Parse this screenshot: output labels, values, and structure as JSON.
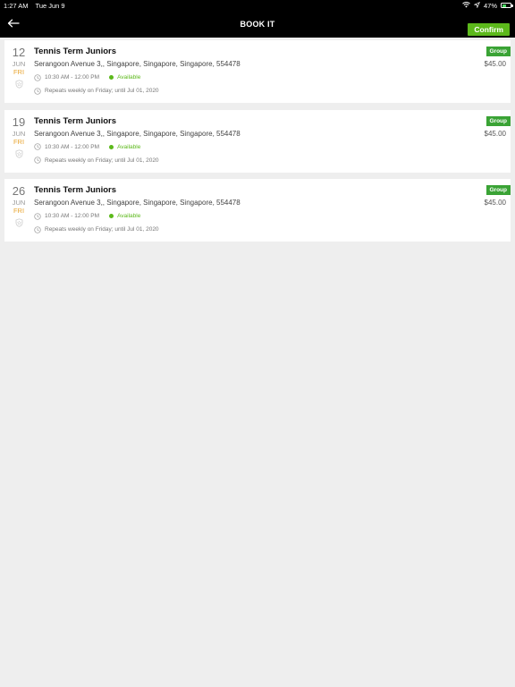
{
  "status_bar": {
    "time": "1:27 AM",
    "date": "Tue Jun 9",
    "battery_percent": "47%",
    "battery_level": 0.47
  },
  "nav": {
    "title": "BOOK IT",
    "back_icon": "arrow-left-icon",
    "confirm_label": "Confirm"
  },
  "colors": {
    "accent_green": "#5cb91b",
    "tag_green": "#3aa335",
    "weekday_orange": "#e8a531",
    "nav_bg": "#000000",
    "page_bg": "#eeeeee"
  },
  "sessions": [
    {
      "day": "12",
      "month": "JUN",
      "weekday": "FRI",
      "title": "Tennis Term Juniors",
      "address": "Serangoon Avenue 3,, Singapore, Singapore, Singapore, 554478",
      "time": "10:30 AM - 12:00 PM",
      "availability": "Available",
      "repeat": "Repeats weekly on Friday; until Jul 01, 2020",
      "tag": "Group",
      "price": "$45.00"
    },
    {
      "day": "19",
      "month": "JUN",
      "weekday": "FRI",
      "title": "Tennis Term Juniors",
      "address": "Serangoon Avenue 3,, Singapore, Singapore, Singapore, 554478",
      "time": "10:30 AM - 12:00 PM",
      "availability": "Available",
      "repeat": "Repeats weekly on Friday; until Jul 01, 2020",
      "tag": "Group",
      "price": "$45.00"
    },
    {
      "day": "26",
      "month": "JUN",
      "weekday": "FRI",
      "title": "Tennis Term Juniors",
      "address": "Serangoon Avenue 3,, Singapore, Singapore, Singapore, 554478",
      "time": "10:30 AM - 12:00 PM",
      "availability": "Available",
      "repeat": "Repeats weekly on Friday; until Jul 01, 2020",
      "tag": "Group",
      "price": "$45.00"
    }
  ]
}
